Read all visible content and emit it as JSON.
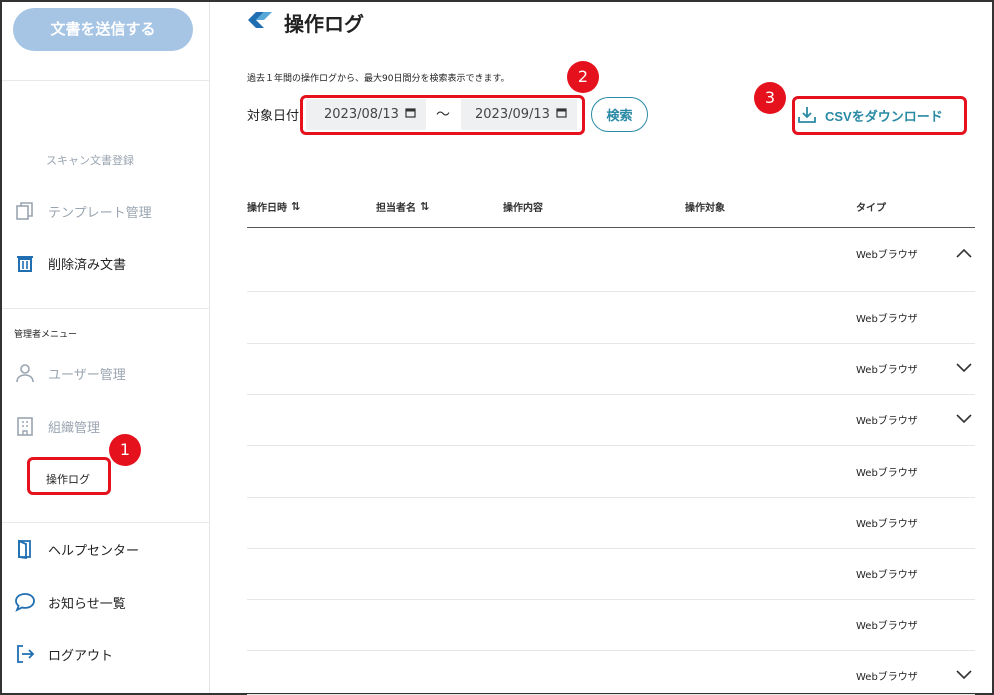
{
  "sidebar": {
    "send_button": "文書を送信する",
    "scan_register": "スキャン文書登録",
    "template_manage": "テンプレート管理",
    "deleted_docs": "削除済み文書",
    "admin_menu_label": "管理者メニュー",
    "user_manage": "ユーザー管理",
    "org_manage": "組織管理",
    "op_log": "操作ログ",
    "help_center": "ヘルプセンター",
    "notices": "お知らせ一覧",
    "logout": "ログアウト"
  },
  "page": {
    "title": "操作ログ",
    "note": "過去１年間の操作ログから、最大90日間分を検索表示できます。",
    "date_label": "対象日付",
    "date_from": "2023/08/13",
    "tilde": "〜",
    "date_to": "2023/09/13",
    "search_label": "検索",
    "csv_label": "CSVをダウンロード"
  },
  "table": {
    "columns": [
      "操作日時",
      "担当者名",
      "操作内容",
      "操作対象",
      "タイプ"
    ],
    "rows": [
      {
        "type": "Webブラウザ",
        "chevron": "up"
      },
      {
        "type": "Webブラウザ",
        "chevron": "none"
      },
      {
        "type": "Webブラウザ",
        "chevron": "down"
      },
      {
        "type": "Webブラウザ",
        "chevron": "down"
      },
      {
        "type": "Webブラウザ",
        "chevron": "none"
      },
      {
        "type": "Webブラウザ",
        "chevron": "none"
      },
      {
        "type": "Webブラウザ",
        "chevron": "none"
      },
      {
        "type": "Webブラウザ",
        "chevron": "none"
      },
      {
        "type": "Webブラウザ",
        "chevron": "down"
      }
    ]
  },
  "annotations": [
    "1",
    "2",
    "3"
  ],
  "colors": {
    "accent": "#2a8aa4",
    "highlight": "#e5121e",
    "send_button": "#a6c4e4",
    "icon_blue": "#1f6fb2"
  }
}
